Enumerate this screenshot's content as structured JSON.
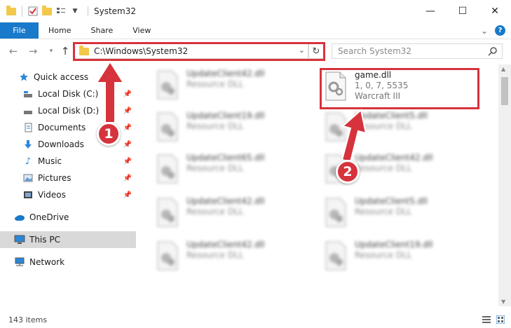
{
  "window": {
    "title": "System32",
    "controls": {
      "minimize": "—",
      "maximize": "☐",
      "close": "✕"
    }
  },
  "ribbon": {
    "tabs": [
      "File",
      "Home",
      "Share",
      "View"
    ],
    "expand_glyph": "⌄",
    "help_glyph": "?"
  },
  "address": {
    "path": "C:\\Windows\\System32",
    "refresh_glyph": "↻",
    "search_placeholder": "Search System32"
  },
  "sidebar": {
    "items": [
      {
        "label": "Quick access",
        "icon": "star-icon",
        "pinned": false
      },
      {
        "label": "Local Disk (C:)",
        "icon": "drive-icon",
        "pinned": true
      },
      {
        "label": "Local Disk (D:)",
        "icon": "drive-icon",
        "pinned": true
      },
      {
        "label": "Documents",
        "icon": "documents-icon",
        "pinned": true
      },
      {
        "label": "Downloads",
        "icon": "download-icon",
        "pinned": true
      },
      {
        "label": "Music",
        "icon": "music-icon",
        "pinned": true
      },
      {
        "label": "Pictures",
        "icon": "pictures-icon",
        "pinned": true
      },
      {
        "label": "Videos",
        "icon": "videos-icon",
        "pinned": true
      },
      {
        "label": "OneDrive",
        "icon": "cloud-icon",
        "pinned": false
      },
      {
        "label": "This PC",
        "icon": "computer-icon",
        "pinned": false,
        "selected": true
      },
      {
        "label": "Network",
        "icon": "network-icon",
        "pinned": false
      }
    ]
  },
  "files": {
    "left": [
      {
        "name": "UpdateClient42.dll",
        "desc": "Resource DLL"
      },
      {
        "name": "UpdateClient19.dll",
        "desc": "Resource DLL"
      },
      {
        "name": "UpdateClient65.dll",
        "desc": "Resource DLL"
      },
      {
        "name": "UpdateClient42.dll",
        "desc": "Resource DLL"
      },
      {
        "name": "UpdateClient42.dll",
        "desc": "Resource DLL"
      }
    ],
    "right": [
      {
        "name": "game.dll",
        "version": "1, 0, 7, 5535",
        "desc": "Warcraft III"
      },
      {
        "name": "UpdateClient5.dll",
        "desc": "Resource DLL"
      },
      {
        "name": "UpdateClient42.dll",
        "desc": "Resource DLL"
      },
      {
        "name": "UpdateClient5.dll",
        "desc": "Resource DLL"
      },
      {
        "name": "UpdateClient19.dll",
        "desc": "Resource DLL"
      }
    ]
  },
  "status": {
    "item_count": "143 items"
  },
  "annotations": {
    "step1": "1",
    "step2": "2",
    "color": "#d6333c"
  }
}
